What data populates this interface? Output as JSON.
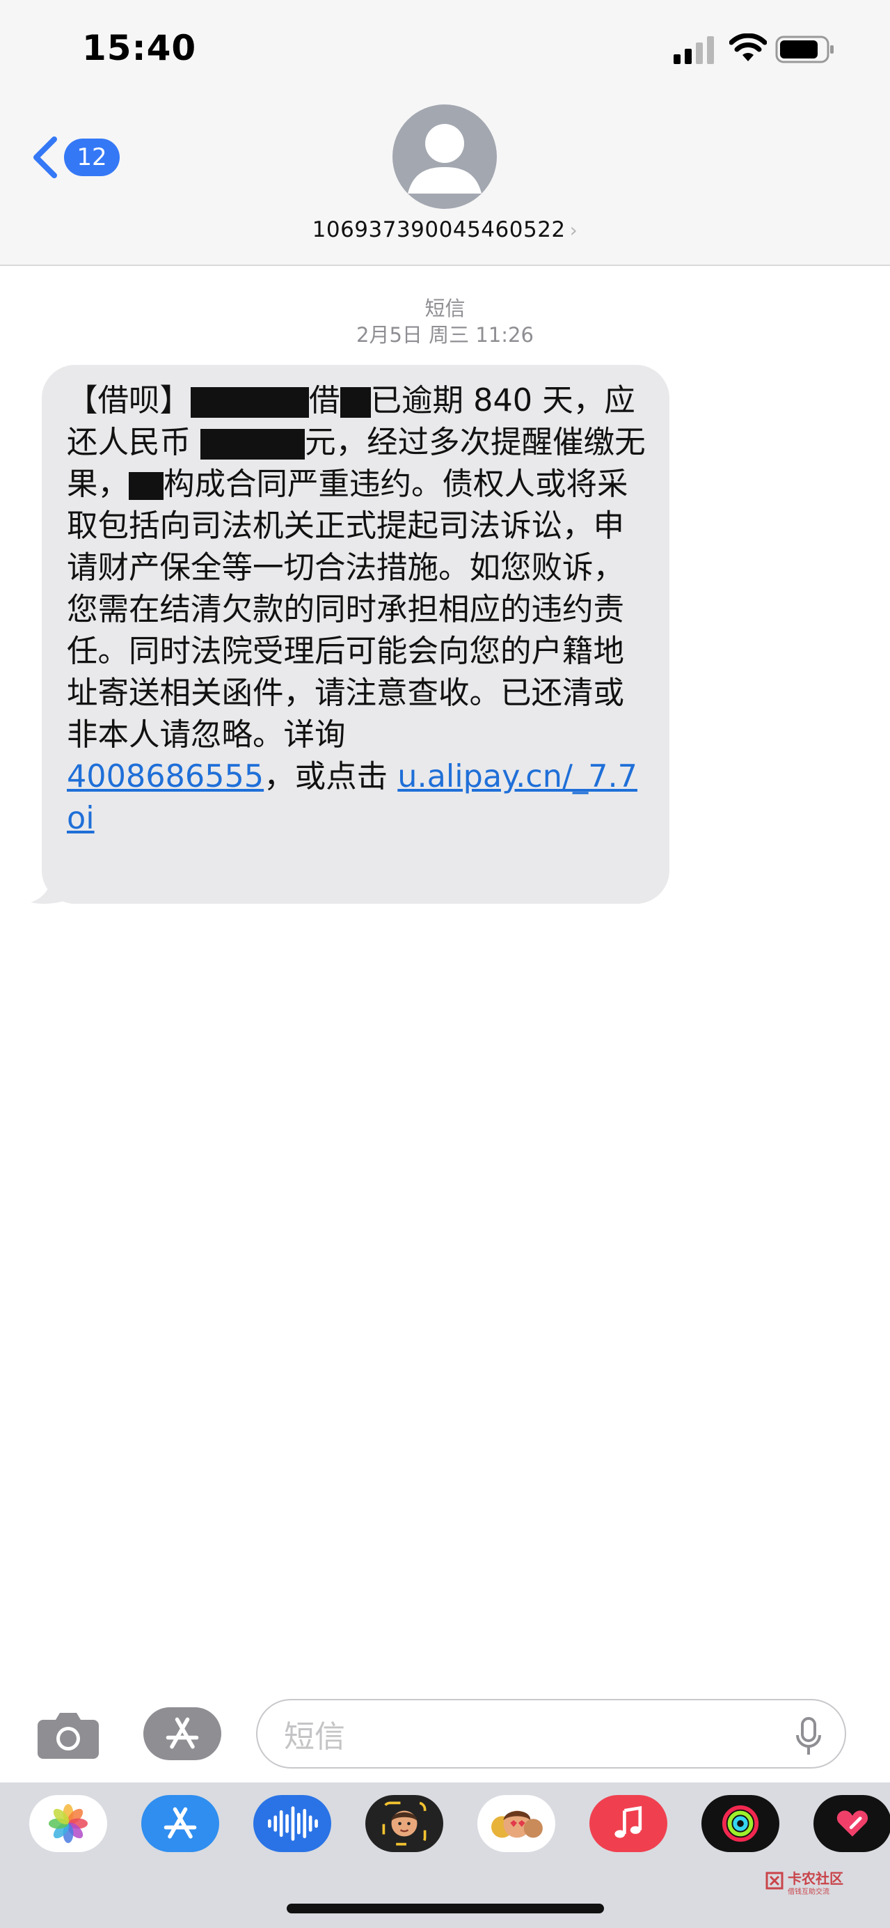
{
  "status_bar": {
    "time": "15:40"
  },
  "nav": {
    "back_count": "12",
    "contact": "106937390045460522",
    "chevron": "›"
  },
  "conversation": {
    "service": "短信",
    "timestamp": "2月5日 周三 11:26",
    "message": {
      "part1": "【借呗】",
      "part2": "借",
      "part3": "已逾期 840 天，应还人民币 ",
      "part4": "元，经过多次提醒催缴无果，",
      "part5": "构成合同严重违约。债权人或将采取包括向司法机关正式提起司法诉讼，申请财产保全等一切合法措施。如您败诉，您需在结清欠款的同时承担相应的违约责任。同时法院受理后可能会向您的户籍地址寄送相关函件，请注意查收。已还清或非本人请忽略。详询",
      "phone_link": "4008686555",
      "part6": "，或点击 ",
      "url_link": "u.alipay.cn/_7.7oi"
    }
  },
  "input": {
    "placeholder": "短信"
  },
  "app_drawer": {
    "apps": [
      "photos-icon",
      "app-store-icon",
      "audio-message-icon",
      "memoji-icon",
      "memoji-stickers-icon",
      "music-icon",
      "activity-icon",
      "digital-touch-icon"
    ]
  },
  "watermark": {
    "main": "卡农社区",
    "sub": "借钱互助交流"
  },
  "colors": {
    "accent": "#3478f6",
    "bubble": "#e9e9eb",
    "link": "#1f6fd8"
  }
}
